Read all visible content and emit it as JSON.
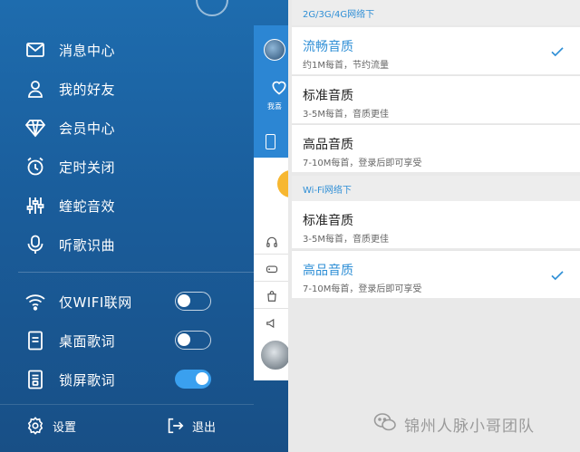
{
  "left_menu": {
    "items": [
      {
        "label": "消息中心",
        "icon": "mail-icon"
      },
      {
        "label": "我的好友",
        "icon": "friends-icon"
      },
      {
        "label": "会员中心",
        "icon": "diamond-icon"
      },
      {
        "label": "定时关闭",
        "icon": "alarm-clock-icon"
      },
      {
        "label": "蝰蛇音效",
        "icon": "equalizer-icon"
      },
      {
        "label": "听歌识曲",
        "icon": "song-recognition-icon"
      }
    ],
    "toggles": [
      {
        "label": "仅WIFI联网",
        "icon": "wifi-icon",
        "on": false
      },
      {
        "label": "桌面歌词",
        "icon": "lyrics-icon",
        "on": false
      },
      {
        "label": "锁屏歌词",
        "icon": "lock-lyrics-icon",
        "on": true
      }
    ],
    "settings_label": "设置",
    "exit_label": "退出"
  },
  "peek_panel": {
    "text": "我喜"
  },
  "quality": {
    "section_mobile": "2G/3G/4G网络下",
    "mobile_options": [
      {
        "title": "流畅音质",
        "sub": "约1M每首，节约流量",
        "selected": true
      },
      {
        "title": "标准音质",
        "sub": "3-5M每首，音质更佳",
        "selected": false
      },
      {
        "title": "高品音质",
        "sub": "7-10M每首，登录后即可享受",
        "selected": false
      }
    ],
    "section_wifi": "Wi-Fi网络下",
    "wifi_options": [
      {
        "title": "标准音质",
        "sub": "3-5M每首，音质更佳",
        "selected": false
      },
      {
        "title": "高品音质",
        "sub": "7-10M每首，登录后即可享受",
        "selected": true
      }
    ]
  },
  "watermark": "锦州人脉小哥团队",
  "colors": {
    "accent": "#2f8fd6",
    "drawer_bg": "#1a5d9b",
    "toggle_on": "#3aa0ef"
  }
}
